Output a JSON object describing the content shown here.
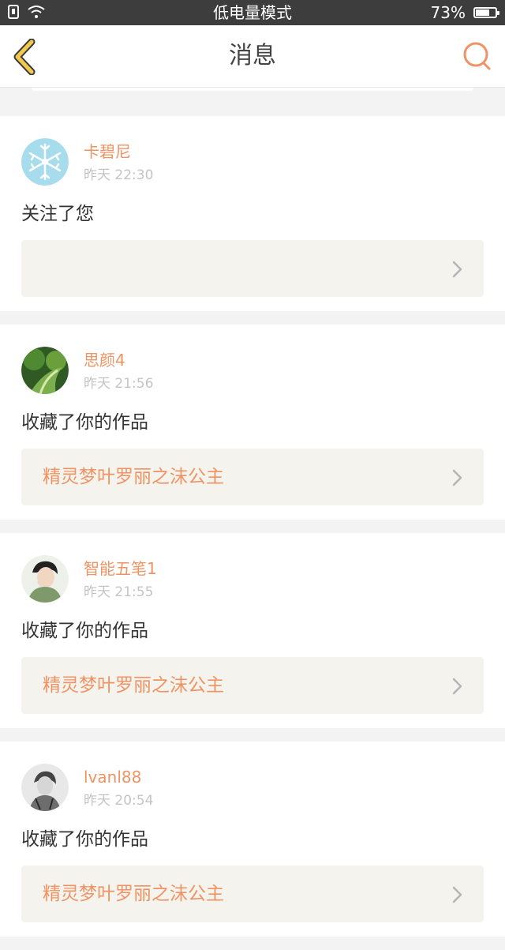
{
  "status_bar": {
    "mode_text": "低电量模式",
    "battery_percent": "73%",
    "battery_level": 0.73,
    "icons": [
      "sim-icon",
      "wifi-icon",
      "battery-icon"
    ]
  },
  "nav": {
    "title": "消息",
    "icons": [
      "back-chevron-icon",
      "search-icon"
    ]
  },
  "colors": {
    "accent": "#ee9464",
    "status_bar_bg": "#3d3d3d",
    "back_icon": "#f2c94c",
    "work_card_bg": "#f4f3ee"
  },
  "messages": [
    {
      "user": "卡碧尼",
      "time": "昨天 22:30",
      "action": "关注了您",
      "work_title": "",
      "avatar": "snowflake-avatar"
    },
    {
      "user": "思颜4",
      "time": "昨天 21:56",
      "action": "收藏了你的作品",
      "work_title": "精灵梦叶罗丽之沫公主",
      "avatar": "forest-avatar"
    },
    {
      "user": "智能五笔1",
      "time": "昨天 21:55",
      "action": "收藏了你的作品",
      "work_title": "精灵梦叶罗丽之沫公主",
      "avatar": "person-avatar"
    },
    {
      "user": "lvanl88",
      "time": "昨天 20:54",
      "action": "收藏了你的作品",
      "work_title": "精灵梦叶罗丽之沫公主",
      "avatar": "sketch-avatar"
    }
  ]
}
